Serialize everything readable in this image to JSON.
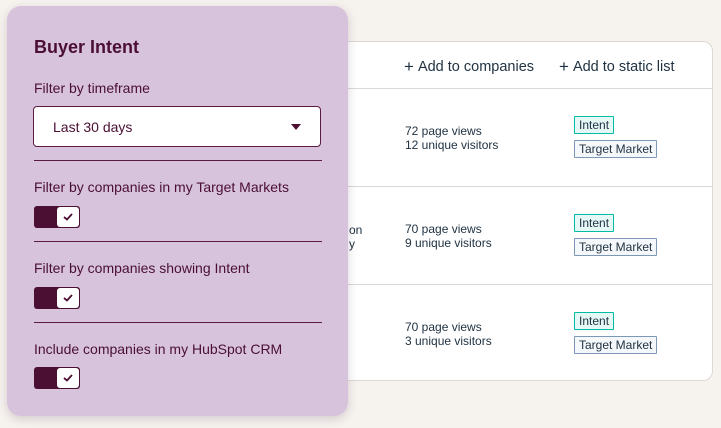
{
  "table": {
    "actions": {
      "add_to_companies": "Add to companies",
      "add_to_static_list": "Add to static list"
    },
    "rows": [
      {
        "partial_text": [
          "",
          ""
        ],
        "page_views": "72 page views",
        "unique_visitors": "12 unique visitors",
        "tags": [
          "Intent",
          "Target Market"
        ]
      },
      {
        "partial_text": [
          "on",
          "y"
        ],
        "page_views": "70 page views",
        "unique_visitors": "9 unique visitors",
        "tags": [
          "Intent",
          "Target Market"
        ]
      },
      {
        "partial_text": [
          "",
          ""
        ],
        "page_views": "70 page views",
        "unique_visitors": "3 unique visitors",
        "tags": [
          "Intent",
          "Target Market"
        ]
      }
    ]
  },
  "panel": {
    "title": "Buyer Intent",
    "timeframe": {
      "label": "Filter by timeframe",
      "selected": "Last 30 days"
    },
    "filters": [
      {
        "label": "Filter by companies in my Target Markets",
        "enabled": true
      },
      {
        "label": "Filter by companies showing Intent",
        "enabled": true
      },
      {
        "label": "Include companies in my HubSpot CRM",
        "enabled": true
      }
    ]
  },
  "colors": {
    "panel_bg": "#d8c3dd",
    "panel_accent": "#4a0f33",
    "intent_tag_border": "#00bda5",
    "target_tag_border": "#7c98b6"
  },
  "icons": {
    "add": "plus-icon",
    "dropdown": "caret-down-icon",
    "toggle": "check-icon"
  }
}
